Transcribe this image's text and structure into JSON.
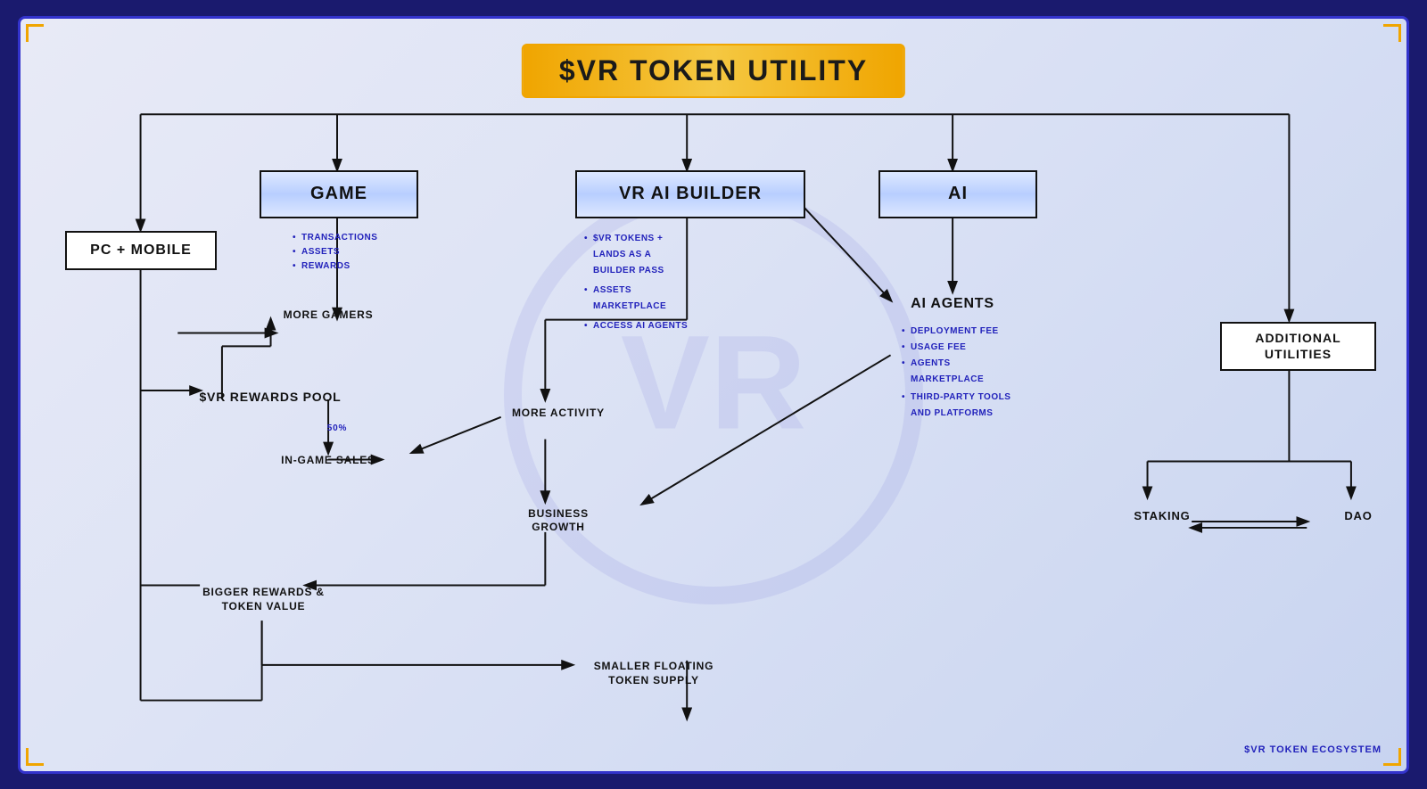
{
  "title": "$VR TOKEN UTILITY",
  "footer": "$VR TOKEN ECOSYSTEM",
  "nodes": {
    "main_title": "$VR TOKEN UTILITY",
    "pc_mobile": "PC + MOBILE",
    "game": "GAME",
    "vr_ai_builder": "VR AI BUILDER",
    "ai": "AI",
    "ai_agents": "AI AGENTS",
    "additional_utilities": "ADDITIONAL\nUTILITIES",
    "rewards_pool": "$VR REWARDS POOL",
    "staking": "STAKING",
    "dao": "DAO"
  },
  "labels": {
    "more_gamers": "MORE\nGAMERS",
    "more_activity": "MORE\nACTIVITY",
    "in_game_sales": "IN-GAME SALES",
    "business_growth": "BUSINESS\nGROWTH",
    "bigger_rewards": "BIGGER REWARDS\n&\nTOKEN VALUE",
    "smaller_floating": "SMALLER FLOATING\nTOKEN SUPPLY",
    "percent_50": "50%"
  },
  "bullets": {
    "game": [
      "TRANSACTIONS",
      "ASSETS",
      "REWARDS"
    ],
    "vr_ai_builder": [
      "$VR TOKENS +\nLANDS AS A\nBUILDER PASS",
      "ASSETS\nMARKETPLACE",
      "ACCESS AI AGENTS"
    ],
    "ai_agents": [
      "DEPLOYMENT FEE",
      "USAGE FEE",
      "AGENTS\nMARKETPLACE",
      "THIRD-PARTY TOOLS\nAND PLATFORMS"
    ]
  }
}
